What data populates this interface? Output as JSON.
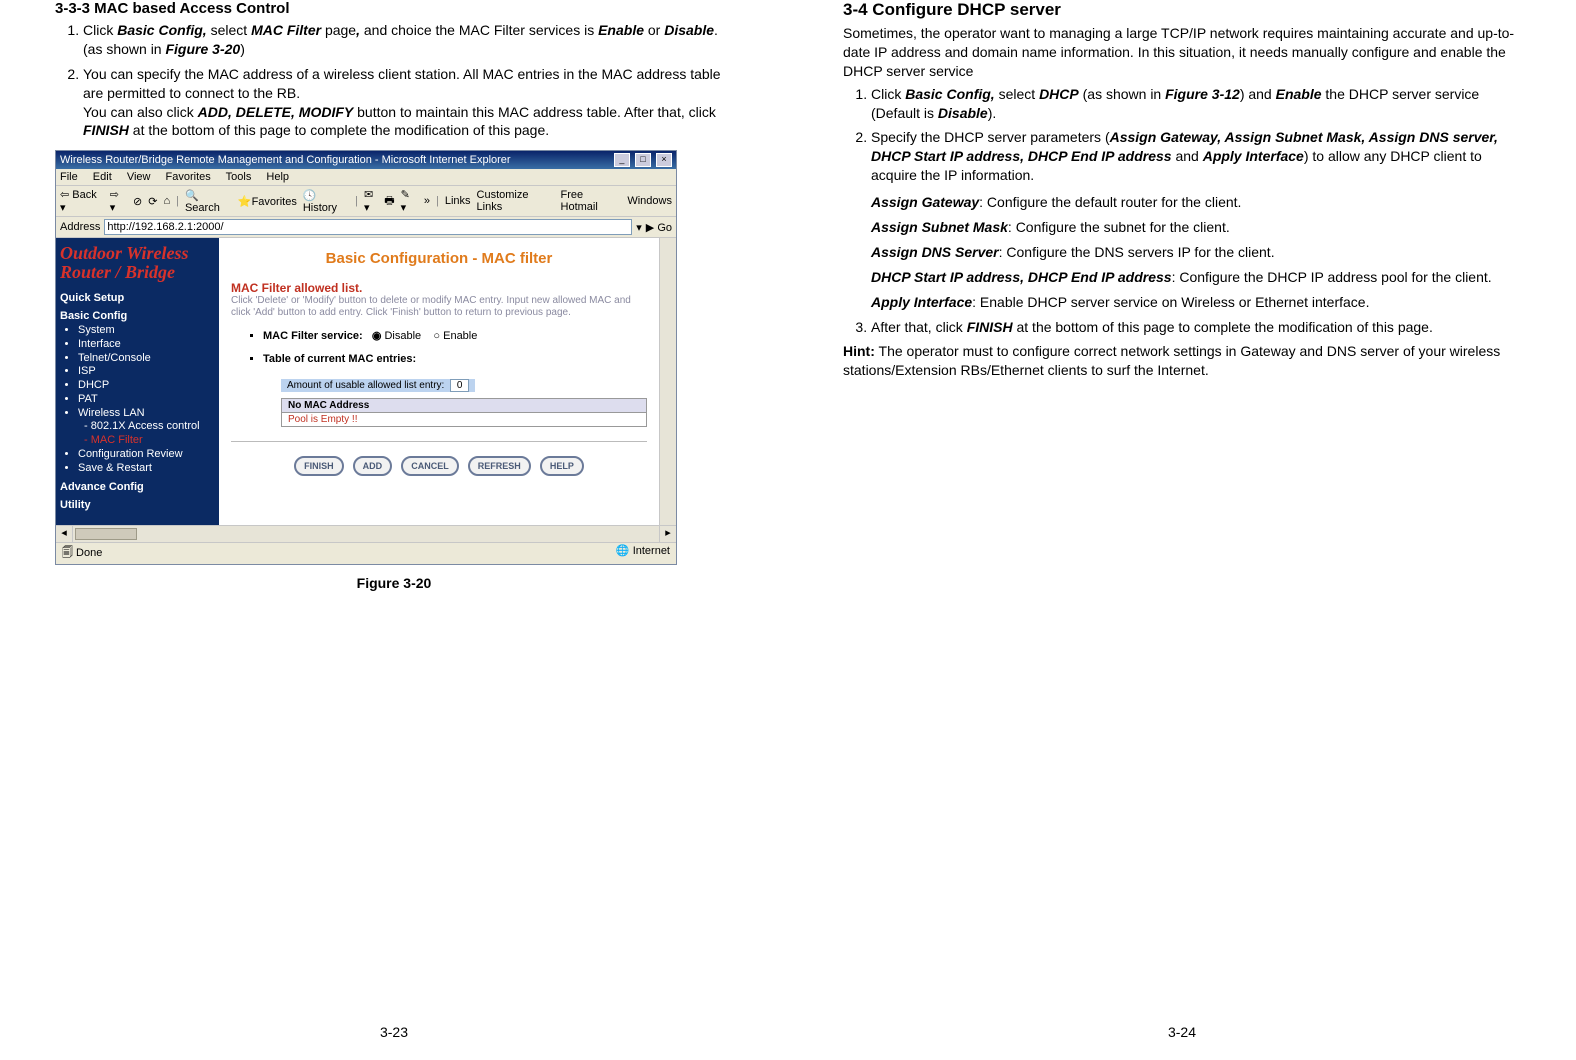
{
  "left": {
    "title": "3-3-3 MAC based Access Control",
    "item1": {
      "pre": "Click ",
      "b1": "Basic Config,",
      "mid1": " select ",
      "b2": "MAC Filter",
      "mid2": " page",
      "b3": ",",
      "mid3": " and choice the MAC Filter services is ",
      "b4": "Enable",
      "mid4": " or ",
      "b5": "Disable",
      "mid5": ". (as shown in ",
      "b6": "Figure 3-20",
      "post": ")"
    },
    "item2": {
      "line1": "You can specify the MAC address of a wireless client station. All MAC entries in the MAC address table are permitted to connect to the RB.",
      "line2a": "You can also click ",
      "line2b": "ADD, DELETE, MODIFY",
      "line2c": " button to maintain this MAC address table. After that, click ",
      "line2d": "FINISH",
      "line2e": " at the bottom of this page to complete the modification of this page."
    },
    "figcaption": "Figure 3-20",
    "pagenum": "3-23",
    "ie": {
      "title": "Wireless Router/Bridge Remote Management and Configuration - Microsoft Internet Explorer",
      "menus": [
        "File",
        "Edit",
        "View",
        "Favorites",
        "Tools",
        "Help"
      ],
      "toolbar": {
        "back": "Back",
        "search": "Search",
        "favorites": "Favorites",
        "history": "History",
        "linkslabel": "Links",
        "l1": "Customize Links",
        "l2": "Free Hotmail",
        "l3": "Windows"
      },
      "addrlabel": "Address",
      "url": "http://192.168.2.1:2000/",
      "go": "Go",
      "brand1": "Outdoor Wireless",
      "brand2": "Router / Bridge",
      "nav": {
        "quick": "Quick Setup",
        "basic": "Basic Config",
        "items": [
          "System",
          "Interface",
          "Telnet/Console",
          "ISP",
          "DHCP",
          "PAT",
          "Wireless LAN"
        ],
        "sub1": "- 802.1X Access control",
        "sub2": "- MAC Filter",
        "items2": [
          "Configuration Review",
          "Save & Restart"
        ],
        "advance": "Advance Config",
        "utility": "Utility"
      },
      "main": {
        "title": "Basic Configuration - MAC filter",
        "listhdr": "MAC Filter allowed list.",
        "desc": "Click 'Delete' or 'Modify' button to delete or modify MAC entry. Input new allowed MAC and click 'Add' button to add entry. Click 'Finish' button to return to previous page.",
        "opt1label": "MAC Filter service:",
        "opt1a": "Disable",
        "opt1b": "Enable",
        "opt2label": "Table of current MAC entries:",
        "countlabel": "Amount of usable allowed list entry:",
        "countval": "0",
        "nohdr": "No MAC Address",
        "empty": "Pool is Empty !!",
        "btns": [
          "FINISH",
          "ADD",
          "CANCEL",
          "REFRESH",
          "HELP"
        ]
      },
      "status": {
        "done": "Done",
        "zone": "Internet"
      }
    }
  },
  "right": {
    "title": "3-4 Configure DHCP server",
    "intro": "Sometimes, the operator want to managing a large TCP/IP network requires maintaining accurate and up-to-date IP address and domain name information. In this situation, it needs manually configure and enable the DHCP server service",
    "item1": {
      "pre": "Click ",
      "b1": "Basic Config,",
      "mid1": " select ",
      "b2": "DHCP",
      "mid2": " (as shown in ",
      "b3": "Figure 3-12",
      "mid3": ") and ",
      "b4": "Enable",
      "mid4": " the DHCP server service (Default is ",
      "b5": "Disable",
      "post": ")."
    },
    "item2": {
      "pre": "Specify the DHCP server parameters (",
      "b1": "Assign Gateway, Assign Subnet Mask, Assign DNS server, DHCP Start IP address, DHCP End IP address",
      "mid": " and ",
      "b2": "Apply Interface",
      "post": ") to allow any DHCP client to acquire the IP information."
    },
    "defs": {
      "d1a": "Assign Gateway",
      "d1b": ": Configure the default router for the client.",
      "d2a": "Assign Subnet Mask",
      "d2b": ": Configure the subnet for the client.",
      "d3a": "Assign DNS Server",
      "d3b": ": Configure the DNS servers IP for the client.",
      "d4a": "DHCP Start IP address, DHCP End IP address",
      "d4b": ": Configure the DHCP IP address pool for the client.",
      "d5a": "Apply Interface",
      "d5b": ": Enable DHCP server service on Wireless or Ethernet interface."
    },
    "item3": {
      "pre": "After that, click ",
      "b1": "FINISH",
      "post": " at the bottom of this page to complete the modification of this page."
    },
    "hint": {
      "label": "Hint:",
      "text": " The operator must to configure correct network settings in Gateway and DNS server of your wireless stations/Extension RBs/Ethernet clients to surf the Internet."
    },
    "pagenum": "3-24"
  }
}
